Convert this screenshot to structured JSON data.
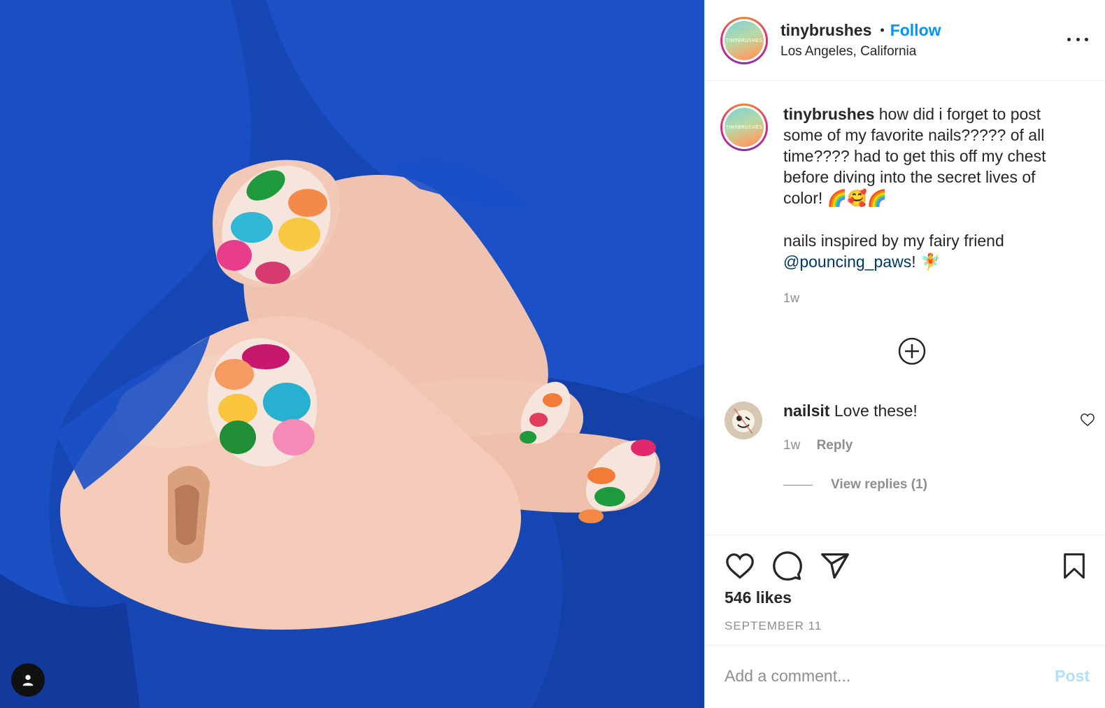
{
  "post": {
    "image": {
      "description_icon": "user-tag-icon"
    },
    "header": {
      "username": "tinybrushes",
      "separator": "•",
      "follow_label": "Follow",
      "location": "Los Angeles, California",
      "avatar_text": "TINYBRUSHES",
      "more_icon": "more-options-icon"
    },
    "caption": {
      "username": "tinybrushes",
      "text_1": "how did i forget to post some of my favorite nails????? of all time???? had to get this off my chest before diving into the secret lives of color!",
      "emojis_1": "🌈🥰🌈",
      "text_2": "nails inspired by my fairy friend",
      "mention": "@pouncing_paws",
      "text_3": "!",
      "emoji_2": "🧚",
      "time": "1w"
    },
    "load_more_icon": "plus-circle-icon",
    "comments": [
      {
        "username": "nailsit",
        "text": "Love these!",
        "time": "1w",
        "reply_label": "Reply",
        "view_replies": "View replies (1)"
      }
    ],
    "actions": {
      "icons": [
        "heart-icon",
        "comment-icon",
        "share-icon",
        "bookmark-icon"
      ]
    },
    "likes": "546 likes",
    "date": "SEPTEMBER 11",
    "add_comment": {
      "placeholder": "Add a comment...",
      "post_label": "Post"
    },
    "colors": {
      "follow": "#0095f6",
      "mention": "#00376b",
      "muted": "#8e8e8e",
      "post_disabled": "#b2dffc",
      "photo_bg": "#1742b3"
    }
  }
}
